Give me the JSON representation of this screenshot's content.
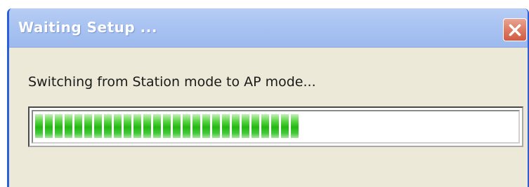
{
  "window": {
    "title": "Waiting Setup ...",
    "close_icon": "close-icon"
  },
  "dialog": {
    "message": "Switching from Station mode to AP mode...",
    "progress_percent": 56
  },
  "colors": {
    "titlebar_text": "#ffffff",
    "close_button": "#de7b64",
    "dialog_background": "#ece9d8",
    "progress_fill": "#22b810",
    "window_border": "#2b5fd9"
  }
}
